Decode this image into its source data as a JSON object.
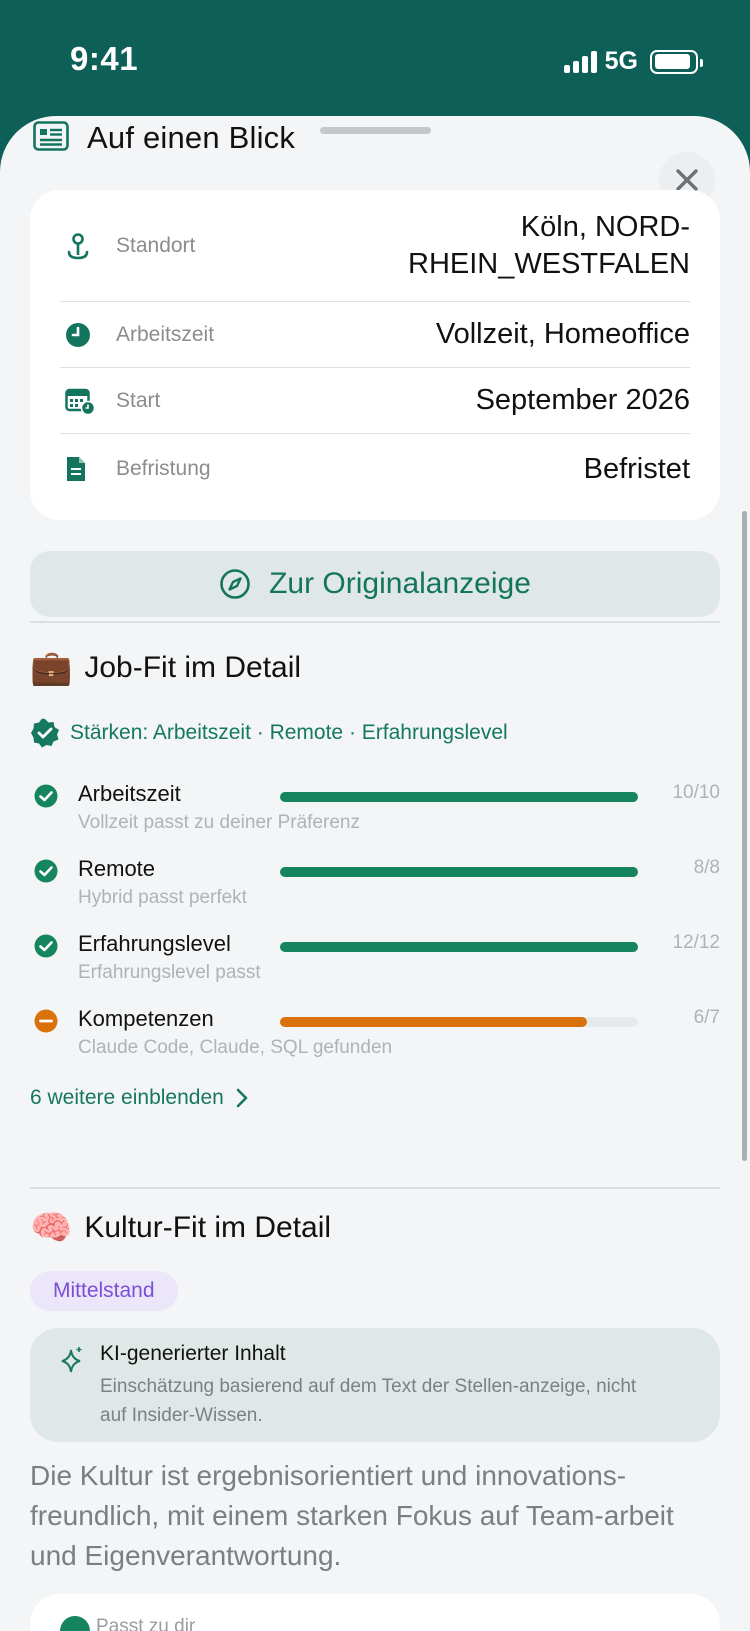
{
  "status_bar": {
    "time": "9:41",
    "network": "5G",
    "battery_percent": 90
  },
  "sheet": {
    "title": "Auf einen Blick"
  },
  "info": [
    {
      "icon": "location-pin-icon",
      "label": "Standort",
      "value_line1": "Köln, NORD-",
      "value_line2": "RHEIN_WESTFALEN"
    },
    {
      "icon": "clock-icon",
      "label": "Arbeitszeit",
      "value": "Vollzeit, Homeoffice"
    },
    {
      "icon": "calendar-clock-icon",
      "label": "Start",
      "value": "September 2026"
    },
    {
      "icon": "document-icon",
      "label": "Befristung",
      "value": "Befristet"
    }
  ],
  "original_button": {
    "label": "Zur Originalanzeige",
    "icon": "compass-icon"
  },
  "job_fit": {
    "emoji": "💼",
    "title": "Job-Fit im Detail",
    "strengths": "Stärken: Arbeitszeit · Remote · Erfahrungslevel",
    "items": [
      {
        "name": "Arbeitszeit",
        "sub": "Vollzeit passt zu deiner Präferenz",
        "score": "10/10",
        "ratio": 1.0,
        "status": "match"
      },
      {
        "name": "Remote",
        "sub": "Hybrid passt perfekt",
        "score": "8/8",
        "ratio": 1.0,
        "status": "match"
      },
      {
        "name": "Erfahrungslevel",
        "sub": "Erfahrungslevel passt",
        "score": "12/12",
        "ratio": 1.0,
        "status": "match"
      },
      {
        "name": "Kompetenzen",
        "sub": "Claude Code, Claude, SQL gefunden",
        "score": "6/7",
        "ratio": 0.857,
        "status": "partial"
      }
    ],
    "more_link": "6 weitere einblenden"
  },
  "culture_fit": {
    "emoji": "🧠",
    "title": "Kultur-Fit im Detail",
    "chip": "Mittelstand",
    "ai_title": "KI-generierter Inhalt",
    "ai_desc": "Einschätzung basierend auf dem Text der Stellen-anzeige, nicht auf Insider-Wissen.",
    "text": "Die Kultur ist ergebnisorientiert und innovations-freundlich, mit einem starken Fokus auf Team-arbeit und Eigenverantwortung.",
    "next_card_label": "Passt zu dir"
  },
  "colors": {
    "header": "#0e5f57",
    "accent": "#15785f",
    "match": "#15855f",
    "partial": "#d9720b",
    "chip_text": "#7b4fd6"
  }
}
